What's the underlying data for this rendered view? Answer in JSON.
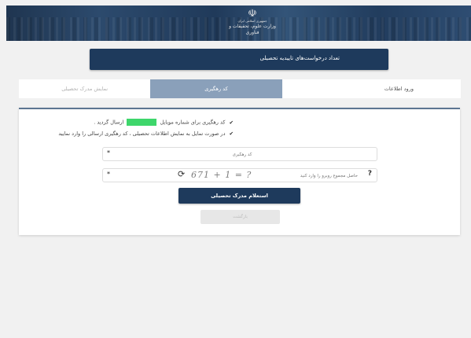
{
  "header": {
    "emblem": "☫",
    "logo_line1": "جمهوری اسلامی ایران",
    "logo_line2": "وزارت علوم، تحقیقات و فناوری"
  },
  "count_bar": {
    "label": "تعداد درخواست‌های تاییدیه تحصیلی"
  },
  "tabs": [
    {
      "label": "نمایش مدرک تحصیلی"
    },
    {
      "label": "کد رهگیری"
    },
    {
      "label": "ورود اطلاعات"
    }
  ],
  "messages": {
    "sms_prefix": "کد رهگیری برای شماره موبایل",
    "sms_suffix": "ارسال گردید .",
    "info": "در صورت تمایل به نمایش اطلاعات تحصیلی ، کد رهگیری ارسالی را وارد نمایید"
  },
  "tracking_field": {
    "placeholder": "کد رهگیری",
    "required_mark": "*"
  },
  "captcha_field": {
    "placeholder": "حاصل مجموع روبرو را وارد کنید",
    "required_mark": "*",
    "help": "?",
    "captcha_text": "671 + 1 = ?"
  },
  "buttons": {
    "inquiry": "استعلام مدرک تحصیلی",
    "back": "بازگشت"
  },
  "colors": {
    "primary": "#1e3a5c",
    "active_tab": "#8aa0ba",
    "highlight": "#3ed66b"
  }
}
